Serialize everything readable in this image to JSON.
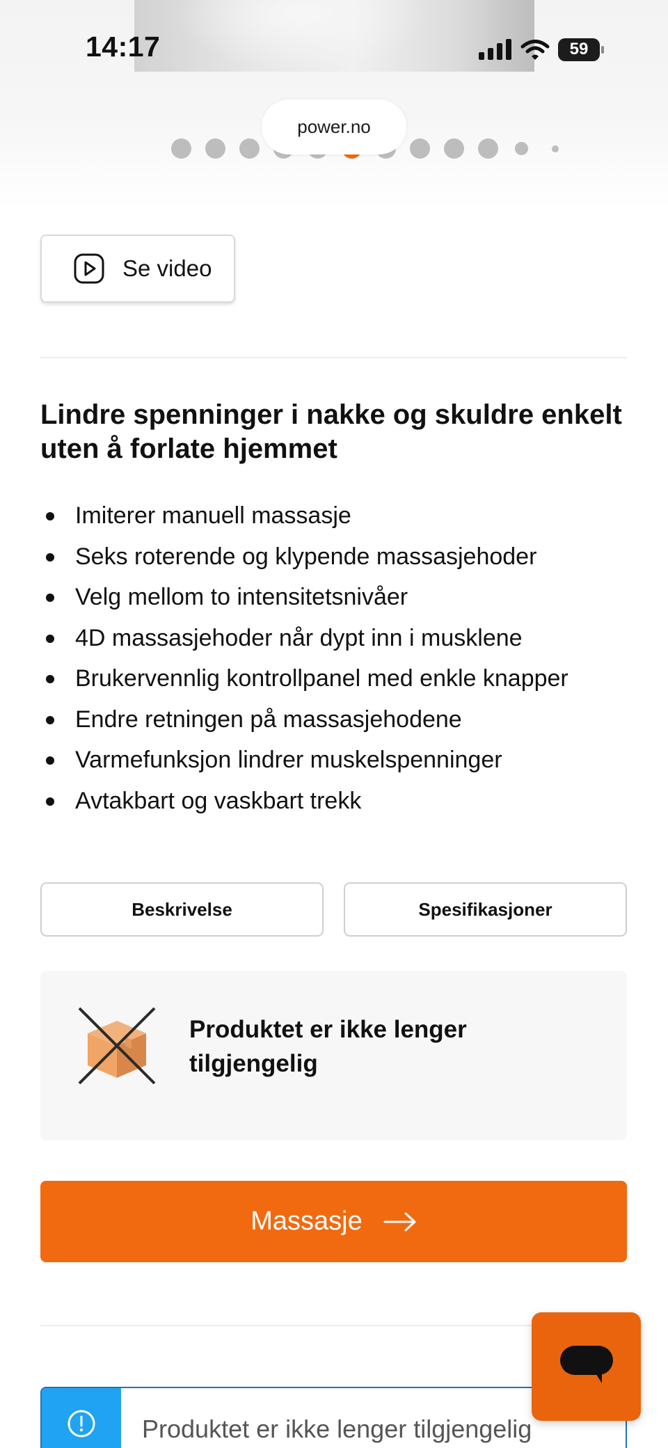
{
  "status_bar": {
    "time": "14:17",
    "battery": "59"
  },
  "browser": {
    "url": "power.no"
  },
  "gallery": {
    "dot_count": 12,
    "active_index": 5
  },
  "video_button": {
    "label": "Se video"
  },
  "product": {
    "headline": "Lindre spenninger i nakke og skuldre enkelt uten å forlate hjemmet",
    "features": [
      "Imiterer manuell massasje",
      "Seks roterende og klypende massasjehoder",
      "Velg mellom to intensitetsnivåer",
      "4D massasjehoder når dypt inn i musklene",
      "Brukervennlig kontrollpanel med enkle knapper",
      "Endre retningen på massasjehodene",
      "Varmefunksjon lindrer muskelspenninger",
      "Avtakbart og vaskbart trekk"
    ]
  },
  "tabs": {
    "description": "Beskrivelse",
    "specifications": "Spesifikasjoner"
  },
  "availability": {
    "message": "Produktet er ikke lenger tilgjengelig"
  },
  "cta": {
    "label": "Massasje"
  },
  "notice": {
    "text": "Produktet er ikke lenger tilgjengelig"
  },
  "colors": {
    "accent": "#f26a0f",
    "info": "#1fa3f2",
    "info_border": "#1e73be",
    "text": "#111111"
  }
}
